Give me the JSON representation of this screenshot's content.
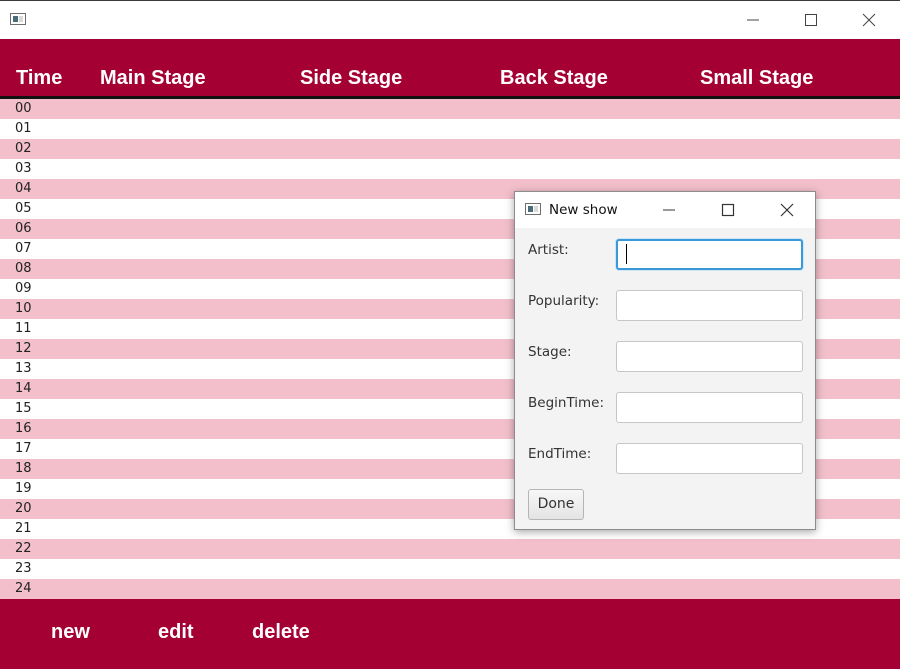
{
  "window": {
    "icon": "app-window-icon"
  },
  "header": {
    "columns": [
      "Time",
      "Main Stage",
      "Side Stage",
      "Back Stage",
      "Small Stage"
    ]
  },
  "rows": [
    "00",
    "01",
    "02",
    "03",
    "04",
    "05",
    "06",
    "07",
    "08",
    "09",
    "10",
    "11",
    "12",
    "13",
    "14",
    "15",
    "16",
    "17",
    "18",
    "19",
    "20",
    "21",
    "22",
    "23",
    "24"
  ],
  "footer": {
    "new_label": "new",
    "edit_label": "edit",
    "delete_label": "delete"
  },
  "dialog": {
    "title": "New show",
    "fields": [
      {
        "label": "Artist:",
        "value": ""
      },
      {
        "label": "Popularity:",
        "value": ""
      },
      {
        "label": "Stage:",
        "value": ""
      },
      {
        "label": "BeginTime:",
        "value": ""
      },
      {
        "label": "EndTime:",
        "value": ""
      }
    ],
    "done_label": "Done"
  },
  "colors": {
    "accent": "#a50034",
    "row_stripe": "#f2bfcb",
    "focus": "#3a9ad9"
  }
}
